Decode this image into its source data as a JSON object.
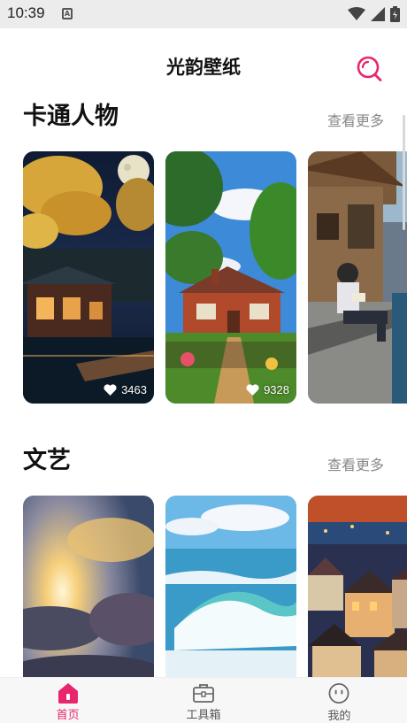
{
  "status_bar": {
    "time": "10:39",
    "notification_glyph": "A",
    "icons": [
      "wifi-icon",
      "signal-icon",
      "battery-icon"
    ]
  },
  "header": {
    "title": "光韵壁纸",
    "search_icon": "search-icon",
    "accent_color": "#e8256d"
  },
  "sections": [
    {
      "title": "卡通人物",
      "more_label": "查看更多",
      "cards": [
        {
          "likes": "3463",
          "scene": "moonlit pavilion with golden tree"
        },
        {
          "likes": "9328",
          "scene": "brick cottage with trees and blue sky"
        },
        {
          "likes": "",
          "scene": "girl reading on canal steps"
        }
      ]
    },
    {
      "title": "文艺",
      "more_label": "查看更多",
      "cards": [
        {
          "likes": "",
          "scene": "sun through clouds"
        },
        {
          "likes": "",
          "scene": "ocean waves"
        },
        {
          "likes": "",
          "scene": "coastal town at dusk"
        }
      ]
    }
  ],
  "bottom_nav": [
    {
      "label": "首页",
      "icon": "home-icon",
      "active": true
    },
    {
      "label": "工具箱",
      "icon": "toolbox-icon",
      "active": false
    },
    {
      "label": "我的",
      "icon": "smiley-face-icon",
      "active": false
    }
  ]
}
